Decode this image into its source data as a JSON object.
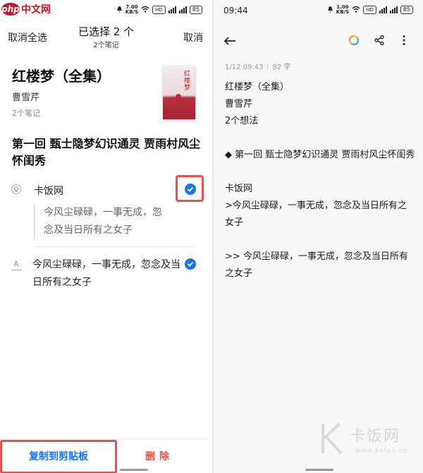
{
  "watermark_logo": {
    "site": "php中文网"
  },
  "left": {
    "status": {
      "speed": "7.00",
      "speed_unit": "KB/S",
      "hd": "HD",
      "battery": "85"
    },
    "toolbar": {
      "deselect_all": "取消全选",
      "title": "已选择 2 个",
      "subtitle": "2个笔记",
      "cancel": "取消"
    },
    "book": {
      "title": "红楼梦（全集）",
      "author": "曹雪芹",
      "note_count": "2个笔记",
      "cover_title": "红楼梦"
    },
    "chapter": "第一回 甄士隐梦幻识通灵 贾雨村风尘怀闺秀",
    "notes": [
      {
        "icon": "comment-icon",
        "text": "卡饭网",
        "quote": "今风尘碌碌，一事无成，忽念及当日所有之女子",
        "checked": true
      },
      {
        "icon": "highlight-icon",
        "text": "今风尘碌碌，一事无成，忽念及当日所有之女子",
        "checked": true
      }
    ],
    "bottom": {
      "copy": "复制到剪贴板",
      "delete": "删除"
    }
  },
  "right": {
    "status": {
      "time": "09:44",
      "speed": "1.00",
      "speed_unit": "KB/S",
      "hd": "HD",
      "battery": "85"
    },
    "meta": {
      "date": "1/12 09:43",
      "chars": "82 字"
    },
    "body": [
      "红楼梦（全集）",
      "曹雪芹",
      "2个想法",
      "",
      "◆ 第一回 甄士隐梦幻识通灵 贾雨村风尘怀闺秀",
      "",
      "卡饭网",
      ">今风尘碌碌，一事无成，忽念及当日所有之女子",
      "",
      ">> 今风尘碌碌，一事无成，忽念及当日所有之女子"
    ],
    "watermark": {
      "text": "卡饭网",
      "url": "www.kafan.cn"
    }
  },
  "colors": {
    "accent_blue": "#1a73e8",
    "highlight_red": "#e0534f",
    "brand_red": "#c6162d"
  }
}
